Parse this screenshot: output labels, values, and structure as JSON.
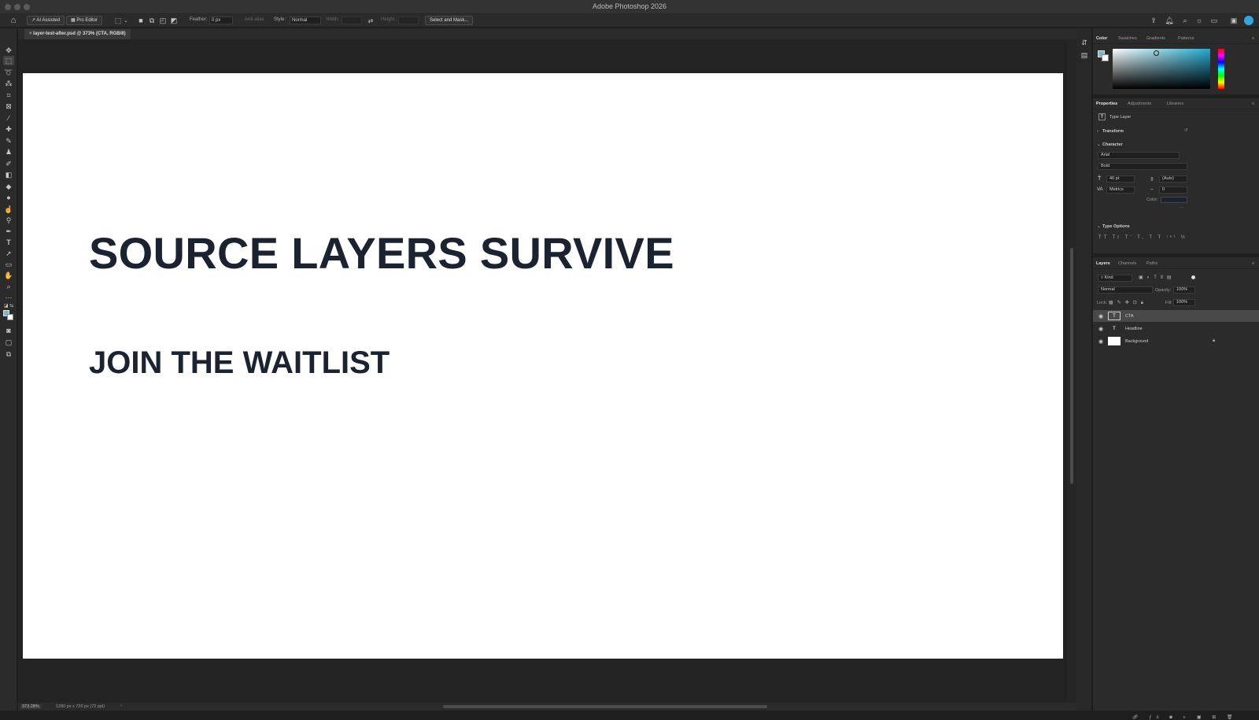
{
  "window": {
    "title": "Adobe Photoshop 2026"
  },
  "options_bar": {
    "ai_assisted": "AI Assisted",
    "pro_editor": "Pro Editor",
    "feather_label": "Feather:",
    "feather_value": "0 px",
    "anti_alias_label": "Anti-alias",
    "style_label": "Style:",
    "style_value": "Normal",
    "width_label": "Width:",
    "height_label": "Height:",
    "select_and_mask": "Select and Mask..."
  },
  "document": {
    "tab_title": "layer-test-after.psd @ 373% (CTA, RGB/8)",
    "headline_text": "SOURCE LAYERS SURVIVE",
    "cta_text": "JOIN THE WAITLIST",
    "zoom": "373.28%",
    "doc_info": "1280 px x 720 px (72 ppi)"
  },
  "color_panel": {
    "tabs": [
      "Color",
      "Swatches",
      "Gradients",
      "Patterns"
    ],
    "active_tab": "Color",
    "foreground_color": "#7fb6cc",
    "hue_color": "#23a9cf"
  },
  "properties_panel": {
    "tabs": [
      "Properties",
      "Adjustments",
      "Libraries"
    ],
    "active_tab": "Properties",
    "layer_type": "Type Layer",
    "transform_label": "Transform",
    "character_label": "Character",
    "font_family": "Arial",
    "font_style": "Bold",
    "font_size": "40 pt",
    "leading": "(Auto)",
    "kerning": "Metrics",
    "tracking": "0",
    "color_label": "Color:",
    "text_color": "#1b2230",
    "type_options_label": "Type Options"
  },
  "layers_panel": {
    "tabs": [
      "Layers",
      "Channels",
      "Paths"
    ],
    "active_tab": "Layers",
    "filter_kind": "Kind",
    "blend_mode": "Normal",
    "opacity_label": "Opacity:",
    "opacity_value": "100%",
    "lock_label": "Lock:",
    "fill_label": "Fill:",
    "fill_value": "100%",
    "layers": [
      {
        "name": "CTA",
        "kind": "type",
        "selected": true
      },
      {
        "name": "Headline",
        "kind": "type",
        "selected": false
      },
      {
        "name": "Background",
        "kind": "pixel",
        "selected": false,
        "locked": true
      }
    ]
  }
}
